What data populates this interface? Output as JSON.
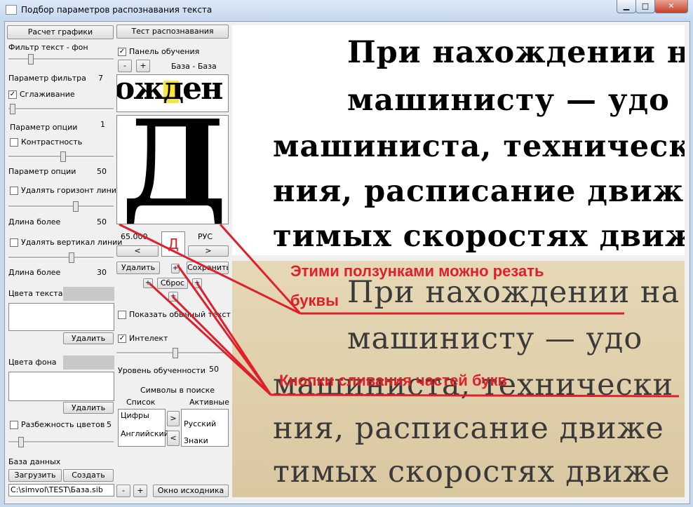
{
  "window": {
    "title": "Подбор параметров распознавания текста",
    "min": "▁",
    "max": "□",
    "close": "✕"
  },
  "left": {
    "calc_button": "Расчет графики",
    "filter_label": "Фильтр текст - фон",
    "filter_param_label": "Параметр фильтра",
    "filter_param_value": "7",
    "smoothing_label": "Сглаживание",
    "smoothing_checked": "✓",
    "option1_label": "Параметр опции",
    "option1_value": "1",
    "contrast_label": "Контрастность",
    "option2_label": "Параметр опции",
    "option2_value": "50",
    "del_horiz_label": "Удалять горизонт линии",
    "length1_label": "Длина более",
    "length1_value": "50",
    "del_vert_label": "Удалять вертикал линии",
    "length2_label": "Длина более",
    "length2_value": "30",
    "text_colors_label": "Цвета текста",
    "delete1_button": "Удалить",
    "bg_colors_label": "Цвета фона",
    "delete2_button": "Удалить",
    "color_spread_label": "Разбежность цветов",
    "color_spread_value": "5",
    "db_label": "База данных",
    "load_button": "Загрузить",
    "create_button": "Создать",
    "db_path": "C:\\simvol\\TEST\\База.sib"
  },
  "middle": {
    "test_button": "Тест распознавания",
    "training_panel_label": "Панель обучения",
    "training_checked": "✓",
    "minus": "-",
    "plus": "+",
    "base_label": "База - База",
    "word_preview": "ожден",
    "glyph_preview": "Д",
    "glyph_value": "65.000",
    "glyph_char": "Д",
    "glyph_lang": "РУС",
    "prev": "<",
    "next": ">",
    "delete_button": "Удалить",
    "save_button": "Сохранить",
    "reset_button": "Сброс",
    "show_text_label": "Показать обычный текст",
    "intellect_label": "Интелект",
    "intellect_checked": "✓",
    "training_level_label": "Уровень обученности",
    "training_level_value": "50",
    "symbols_label": "Символы в поиске",
    "list_header": "Список",
    "active_header": "Активные",
    "list_items": [
      "Цифры",
      "Английский"
    ],
    "active_items": [
      "Русский",
      "Знаки"
    ],
    "move_right": ">",
    "move_left": "<",
    "source_window_button": "Окно исходника"
  },
  "document": {
    "lines": [
      "При нахождении на",
      "машинисту — удо",
      "машиниста, технически",
      "ния, расписание движе",
      "тимых скоростях движе"
    ]
  },
  "annotations": {
    "sliders_note_1": "Этими ползунками можно резать",
    "sliders_note_2": "буквы",
    "merge_note": "Кнопки сливания частей букв"
  },
  "colors": {
    "annotation_red": "#e01f2a"
  }
}
